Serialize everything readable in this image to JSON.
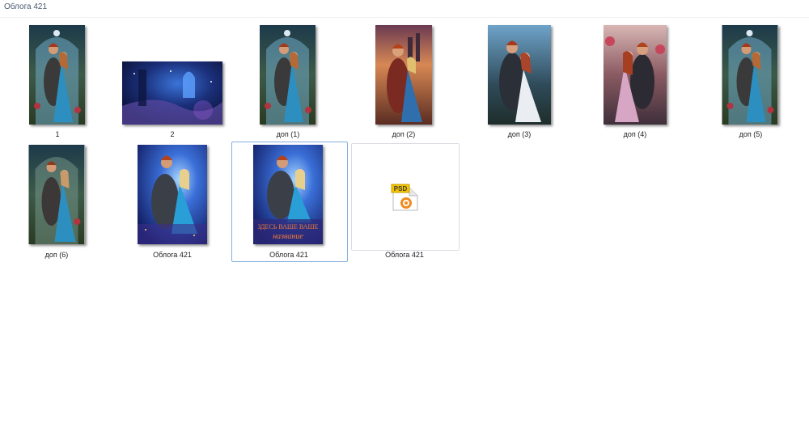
{
  "window": {
    "title": "Облога 421"
  },
  "files": [
    {
      "name": "1",
      "kind": "image",
      "scene": "knight-lady-blue"
    },
    {
      "name": "2",
      "kind": "image",
      "scene": "blue-night-landscape"
    },
    {
      "name": "доп (1)",
      "kind": "image",
      "scene": "knight-lady-blue"
    },
    {
      "name": "доп (2)",
      "kind": "image",
      "scene": "sunset-castle"
    },
    {
      "name": "доп (3)",
      "kind": "image",
      "scene": "knight-lady-white"
    },
    {
      "name": "доп (4)",
      "kind": "image",
      "scene": "knight-lady-pink"
    },
    {
      "name": "доп (5)",
      "kind": "image",
      "scene": "knight-lady-blue"
    },
    {
      "name": "доп (6)",
      "kind": "image",
      "scene": "knight-lady-blue"
    },
    {
      "name": "Облога  421",
      "kind": "image",
      "scene": "blue-cover"
    },
    {
      "name": "Облога 421",
      "kind": "image",
      "scene": "blue-cover-titled",
      "selected": true,
      "cover_text": {
        "line1": "ЗДЕСЬ ВАШЕ ВАШЕ",
        "line2": "название"
      }
    },
    {
      "name": "Облога 421",
      "kind": "psd",
      "icon": "psd-file-icon",
      "badge": "PSD"
    }
  ],
  "colors": {
    "selection_border": "#84acdd",
    "psd_badge": "#f4c400",
    "psd_orange": "#f08a1e"
  }
}
